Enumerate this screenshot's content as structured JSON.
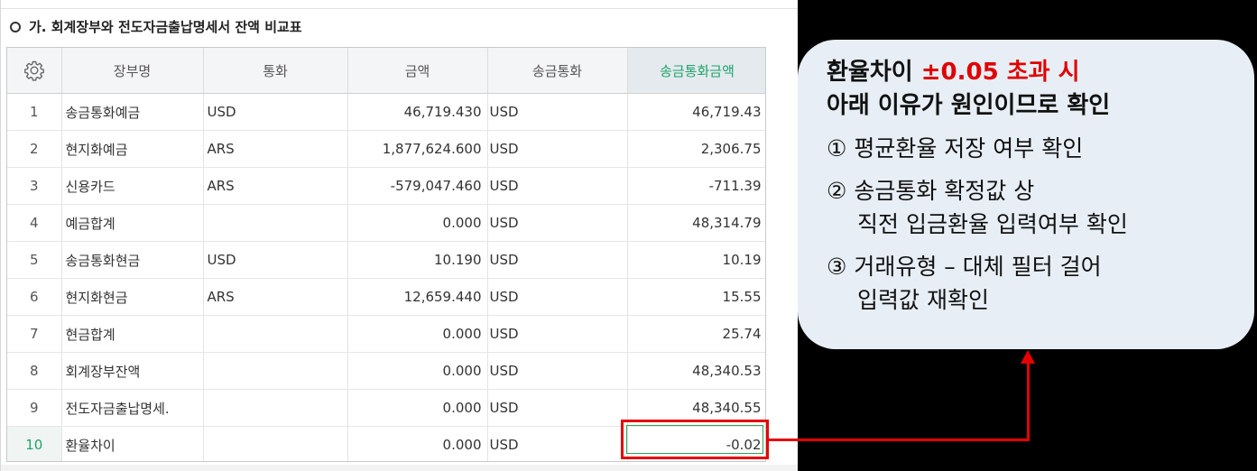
{
  "section": {
    "title": "가. 회계장부와 전도자금출납명세서 잔액 비교표"
  },
  "grid": {
    "columns": [
      "장부명",
      "통화",
      "금액",
      "송금통화",
      "송금통화금액"
    ],
    "rows": [
      {
        "no": "1",
        "book": "송금통화예금",
        "currency": "USD",
        "amount": "46,719.430",
        "remit_currency": "USD",
        "remit_amount": "46,719.43"
      },
      {
        "no": "2",
        "book": "현지화예금",
        "currency": "ARS",
        "amount": "1,877,624.600",
        "remit_currency": "USD",
        "remit_amount": "2,306.75"
      },
      {
        "no": "3",
        "book": "신용카드",
        "currency": "ARS",
        "amount": "-579,047.460",
        "remit_currency": "USD",
        "remit_amount": "-711.39"
      },
      {
        "no": "4",
        "book": "예금합계",
        "currency": "",
        "amount": "0.000",
        "remit_currency": "USD",
        "remit_amount": "48,314.79"
      },
      {
        "no": "5",
        "book": "송금통화현금",
        "currency": "USD",
        "amount": "10.190",
        "remit_currency": "USD",
        "remit_amount": "10.19"
      },
      {
        "no": "6",
        "book": "현지화현금",
        "currency": "ARS",
        "amount": "12,659.440",
        "remit_currency": "USD",
        "remit_amount": "15.55"
      },
      {
        "no": "7",
        "book": "현금합계",
        "currency": "",
        "amount": "0.000",
        "remit_currency": "USD",
        "remit_amount": "25.74"
      },
      {
        "no": "8",
        "book": "회계장부잔액",
        "currency": "",
        "amount": "0.000",
        "remit_currency": "USD",
        "remit_amount": "48,340.53"
      },
      {
        "no": "9",
        "book": "전도자금출납명세.",
        "currency": "",
        "amount": "0.000",
        "remit_currency": "USD",
        "remit_amount": "48,340.55"
      },
      {
        "no": "10",
        "book": "환율차이",
        "currency": "",
        "amount": "0.000",
        "remit_currency": "USD",
        "remit_amount": "-0.02"
      }
    ]
  },
  "callout": {
    "line1_prefix": "환율차이 ",
    "line1_highlight": "±0.05 초과 시",
    "line2": "아래 이유가 원인이므로 확인",
    "item1": "① 평균환율 저장 여부 확인",
    "item2_line1": "② 송금통화 확정값 상",
    "item2_line2": "직전 입금환율 입력여부 확인",
    "item3_line1": "③ 거래유형 – 대체 필터 걸어",
    "item3_line2": "입력값 재확인"
  },
  "colors": {
    "accent_green": "#1fa36a",
    "highlight_red": "#e60000",
    "callout_bg": "#e8eef5"
  }
}
